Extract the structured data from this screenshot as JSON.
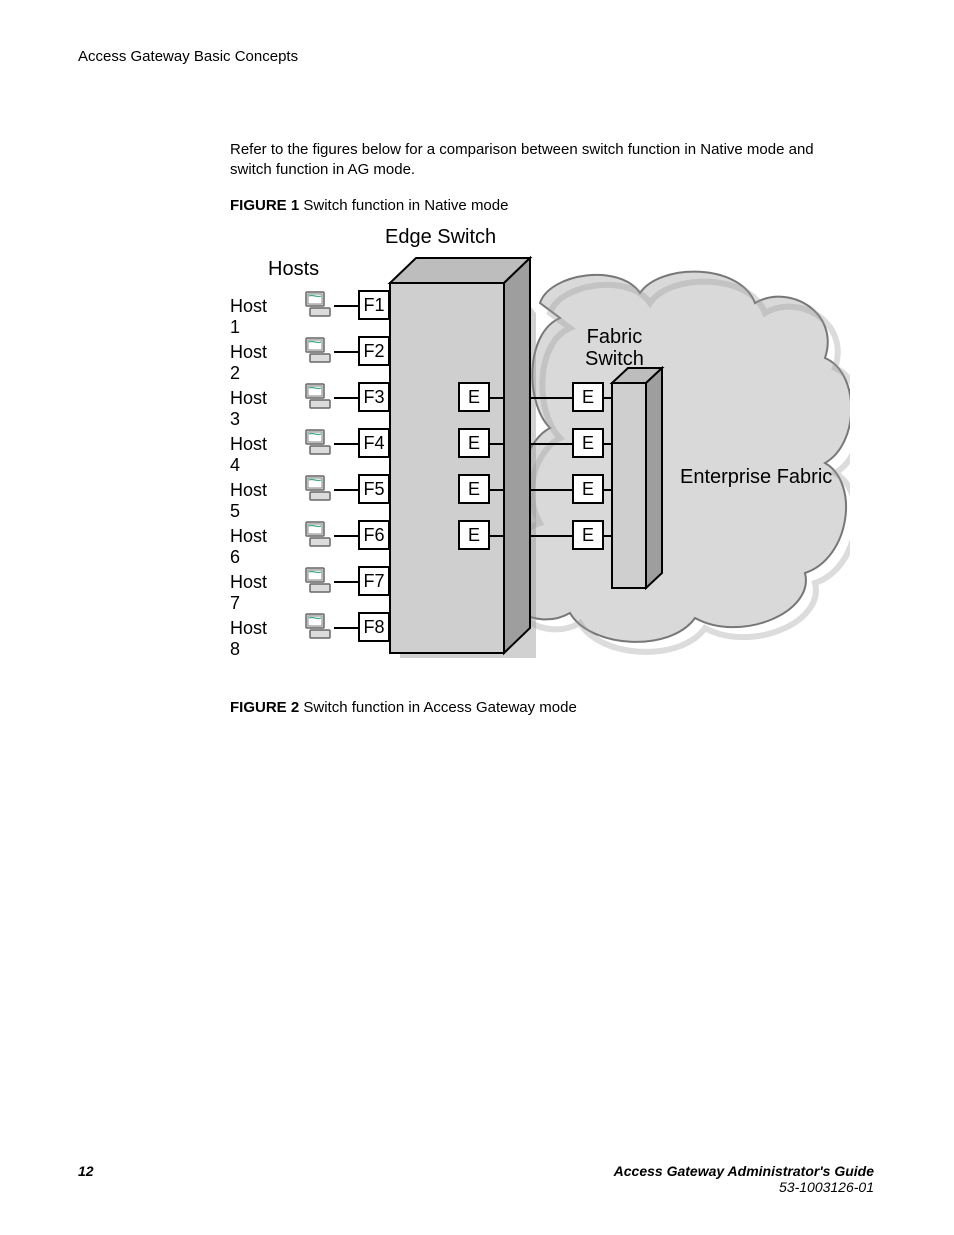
{
  "header": {
    "section": "Access Gateway Basic Concepts"
  },
  "intro": "Refer to the figures below for a comparison between switch function in Native mode and switch function in AG mode.",
  "figure1": {
    "label": "FIGURE 1",
    "caption": "Switch function in Native mode"
  },
  "figure2": {
    "label": "FIGURE 2",
    "caption": "Switch function in Access Gateway mode"
  },
  "diagram": {
    "edge_switch": "Edge Switch",
    "hosts_header": "Hosts",
    "fabric_switch_line1": "Fabric",
    "fabric_switch_line2": "Switch",
    "enterprise_fabric": "Enterprise Fabric",
    "hosts": [
      {
        "name": "Host 1",
        "port": "F1"
      },
      {
        "name": "Host 2",
        "port": "F2"
      },
      {
        "name": "Host 3",
        "port": "F3"
      },
      {
        "name": "Host 4",
        "port": "F4"
      },
      {
        "name": "Host 5",
        "port": "F5"
      },
      {
        "name": "Host 6",
        "port": "F6"
      },
      {
        "name": "Host 7",
        "port": "F7"
      },
      {
        "name": "Host 8",
        "port": "F8"
      }
    ],
    "e_port": "E",
    "e_rows": [
      2,
      3,
      4,
      5
    ]
  },
  "footer": {
    "page": "12",
    "title": "Access Gateway Administrator's Guide",
    "docnum": "53-1003126-01"
  }
}
